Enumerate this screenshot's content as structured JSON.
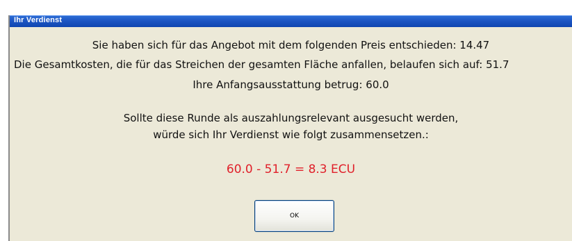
{
  "window": {
    "title": "Ihr Verdienst"
  },
  "message": {
    "line1": "Sie haben sich für das Angebot mit dem folgenden Preis entschieden:  14.47",
    "line2": "Die Gesamtkosten, die für das Streichen der gesamten Fläche anfallen, belaufen sich auf:  51.7",
    "line3": "Ihre Anfangsausstattung betrug:  60.0",
    "line4": "Sollte diese Runde als auszahlungsrelevant ausgesucht werden,",
    "line5": "würde sich Ihr Verdienst wie folgt zusammensetzen.:",
    "result": "60.0 - 51.7 = 8.3 ECU"
  },
  "buttons": {
    "ok_label": "OK"
  },
  "colors": {
    "titlebar": "#1d56c4",
    "dialog_background": "#ece9d8",
    "result_text": "#e0202a"
  }
}
